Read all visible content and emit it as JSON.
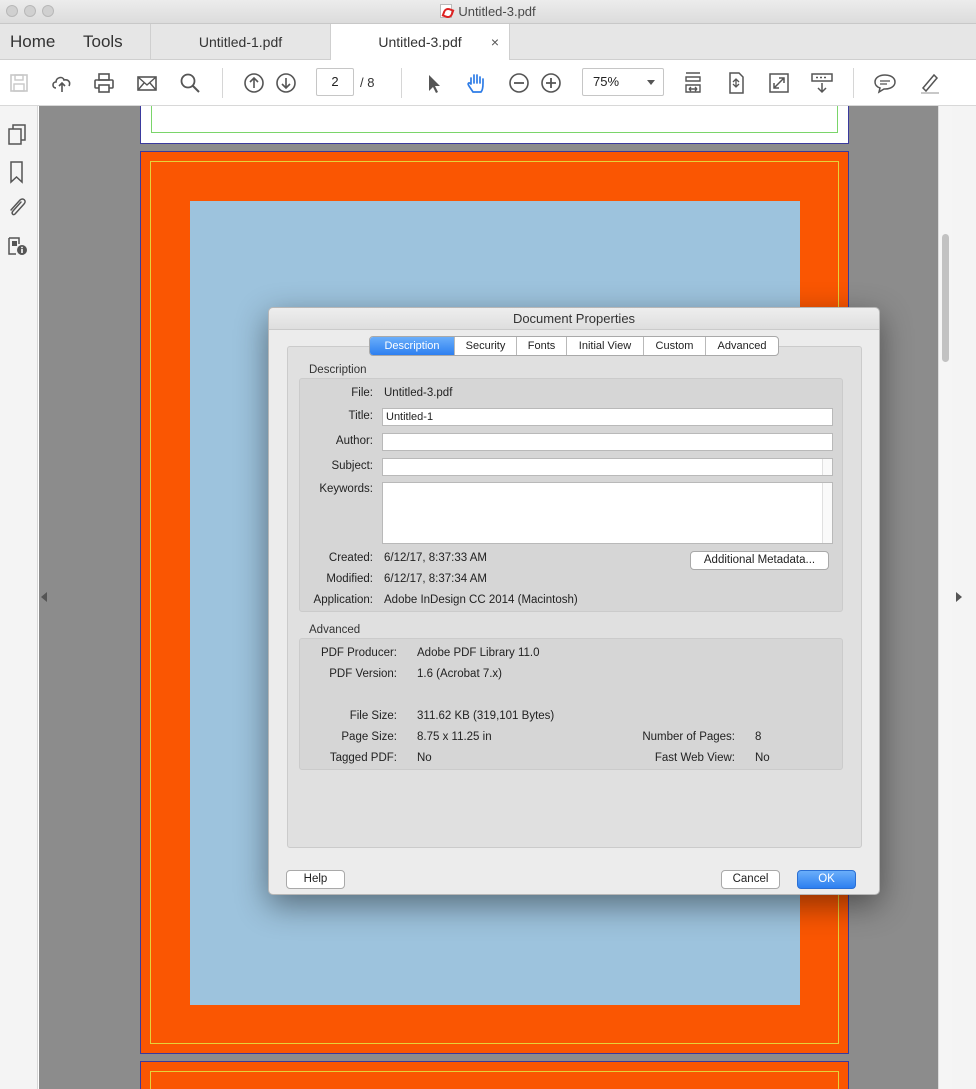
{
  "window": {
    "title": "Untitled-3.pdf"
  },
  "nav": {
    "home": "Home",
    "tools": "Tools"
  },
  "tabs": [
    {
      "label": "Untitled-1.pdf",
      "active": false
    },
    {
      "label": "Untitled-3.pdf",
      "active": true,
      "close": "×"
    }
  ],
  "toolbar": {
    "page_current": "2",
    "page_total": "/ 8",
    "zoom": "75%",
    "icons": [
      "save-icon",
      "upload-cloud-icon",
      "print-icon",
      "email-icon",
      "search-icon",
      "page-up-icon",
      "page-down-icon",
      "select-arrow-icon",
      "hand-tool-icon",
      "zoom-out-icon",
      "zoom-in-icon",
      "scroll-mode-icon",
      "fit-page-icon",
      "full-screen-icon",
      "read-mode-icon",
      "comment-icon",
      "highlight-icon"
    ]
  },
  "left_panel": {
    "icons": [
      "pages-icon",
      "bookmark-icon",
      "attachment-icon",
      "security-info-icon"
    ]
  },
  "colors": {
    "page_orange": "#fa5602",
    "page_blue": "#9dc3dd",
    "accent_blue": "#2d7ff0",
    "hand_tool": "#2e7ce6"
  },
  "dialog": {
    "title": "Document Properties",
    "tabs": [
      "Description",
      "Security",
      "Fonts",
      "Initial View",
      "Custom",
      "Advanced"
    ],
    "active_tab": "Description",
    "description": {
      "heading": "Description",
      "file_label": "File:",
      "file_value": "Untitled-3.pdf",
      "title_label": "Title:",
      "title_value": "Untitled-1",
      "author_label": "Author:",
      "author_value": "",
      "subject_label": "Subject:",
      "subject_value": "",
      "keywords_label": "Keywords:",
      "keywords_value": "",
      "created_label": "Created:",
      "created_value": "6/12/17, 8:37:33 AM",
      "modified_label": "Modified:",
      "modified_value": "6/12/17, 8:37:34 AM",
      "application_label": "Application:",
      "application_value": "Adobe InDesign CC 2014 (Macintosh)",
      "metadata_button": "Additional Metadata..."
    },
    "advanced": {
      "heading": "Advanced",
      "producer_label": "PDF Producer:",
      "producer_value": "Adobe PDF Library 11.0",
      "version_label": "PDF Version:",
      "version_value": "1.6 (Acrobat 7.x)",
      "filesize_label": "File Size:",
      "filesize_value": "311.62 KB (319,101 Bytes)",
      "pagesize_label": "Page Size:",
      "pagesize_value": "8.75 x 11.25 in",
      "numpages_label": "Number of Pages:",
      "numpages_value": "8",
      "tagged_label": "Tagged PDF:",
      "tagged_value": "No",
      "fastweb_label": "Fast Web View:",
      "fastweb_value": "No"
    },
    "buttons": {
      "help": "Help",
      "cancel": "Cancel",
      "ok": "OK"
    }
  }
}
